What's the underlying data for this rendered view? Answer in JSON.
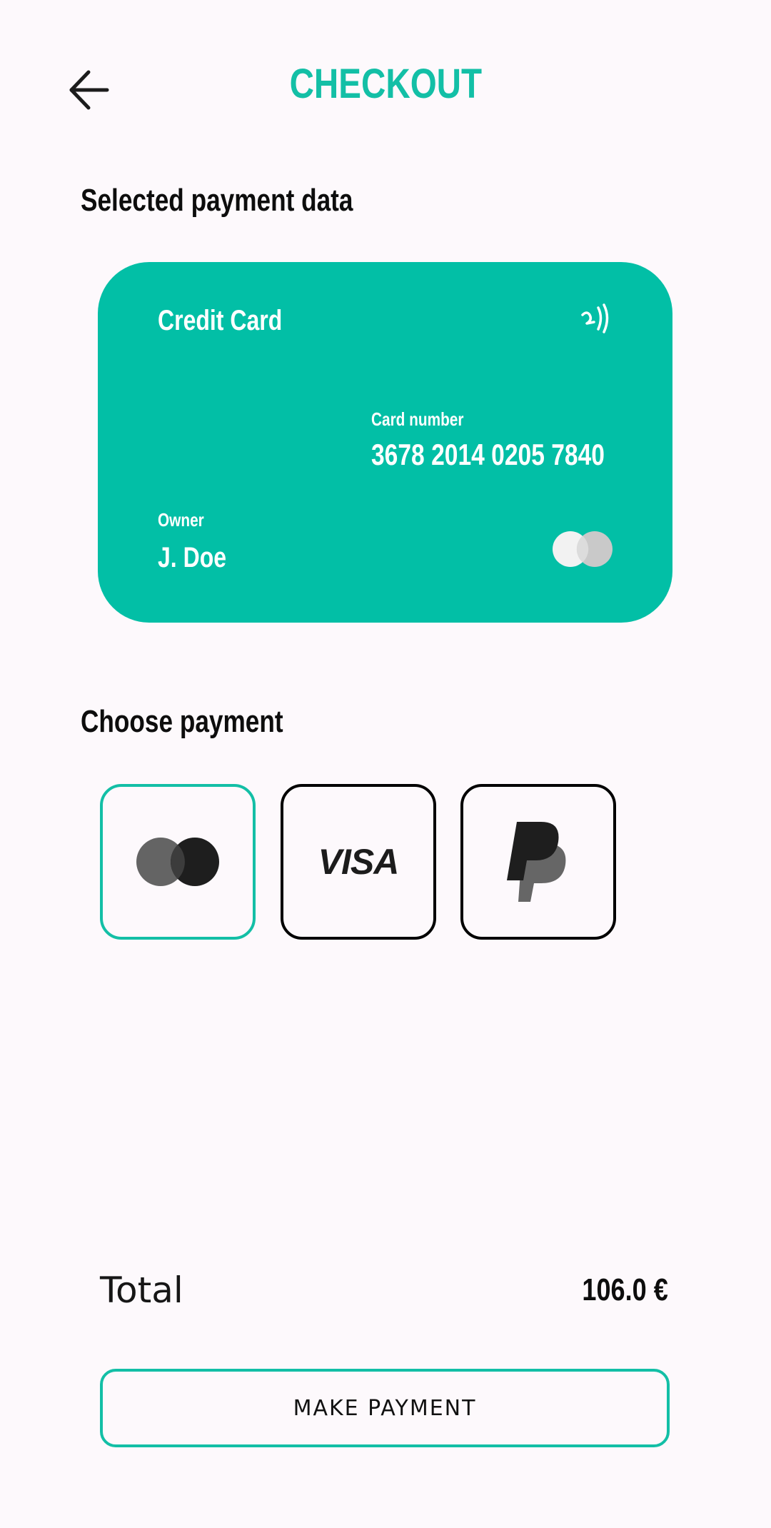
{
  "header": {
    "title": "CHECKOUT",
    "back_icon": "arrow-left-icon"
  },
  "selected_section": {
    "title": "Selected payment data"
  },
  "card": {
    "type": "Credit Card",
    "number_label": "Card number",
    "number": "3678 2014 0205 7840",
    "owner_label": "Owner",
    "owner": "J. Doe",
    "icons": [
      "contactless-icon",
      "mastercard-logo-icon"
    ],
    "background_color": "#02bfa6"
  },
  "choose_section": {
    "title": "Choose payment",
    "options": [
      {
        "name": "mastercard",
        "icon": "mastercard-logo-icon",
        "selected": true
      },
      {
        "name": "visa",
        "label": "VISA",
        "icon": "visa-logo-icon",
        "selected": false
      },
      {
        "name": "paypal",
        "icon": "paypal-logo-icon",
        "selected": false
      }
    ]
  },
  "total": {
    "label": "Total",
    "value": "106.0 €"
  },
  "actions": {
    "make_payment_label": "MAKE PAYMENT"
  },
  "colors": {
    "accent": "#13bfa6",
    "background": "#fdf9fc",
    "text": "#111111"
  }
}
